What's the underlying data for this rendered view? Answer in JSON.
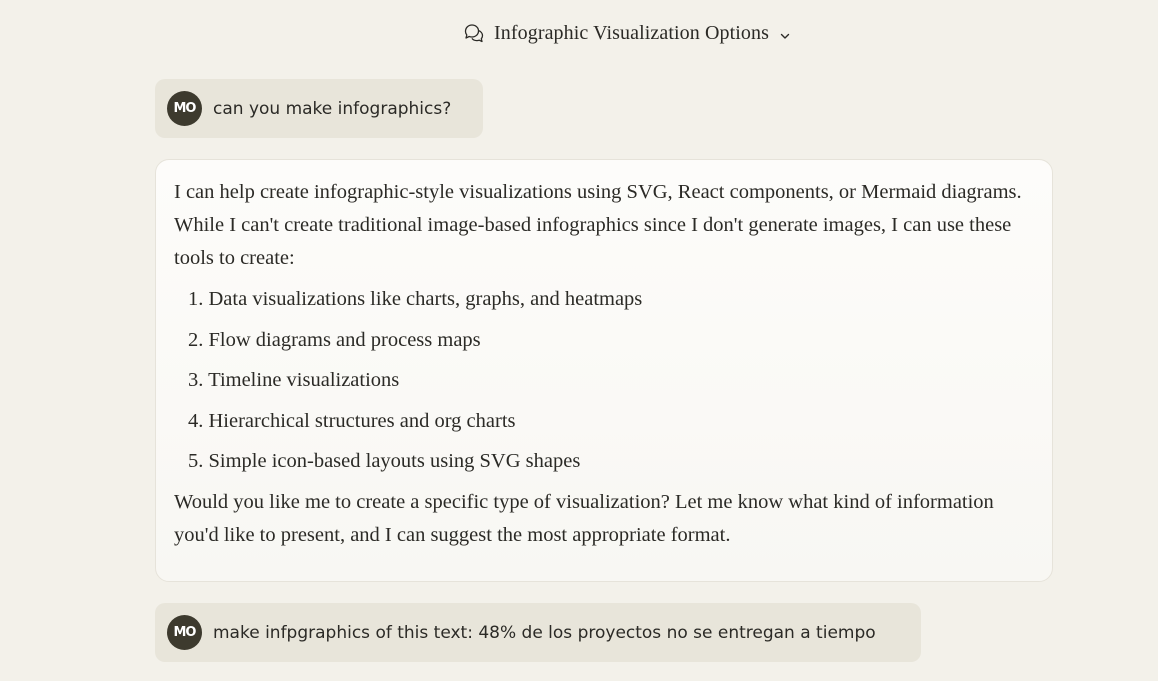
{
  "header": {
    "title": "Infographic Visualization Options",
    "icon": "chat-bubbles-icon",
    "dropdown_icon": "chevron-down-icon"
  },
  "messages": {
    "user1": {
      "avatar": "MO",
      "text": "can you make infographics?"
    },
    "assistant": {
      "intro": "I can help create infographic-style visualizations using SVG, React components, or Mermaid diagrams. While I can't create traditional image-based infographics since I don't generate images, I can use these tools to create:",
      "items": [
        {
          "num": "1.",
          "text": "Data visualizations like charts, graphs, and heatmaps"
        },
        {
          "num": "2.",
          "text": "Flow diagrams and process maps"
        },
        {
          "num": "3.",
          "text": "Timeline visualizations"
        },
        {
          "num": "4.",
          "text": "Hierarchical structures and org charts"
        },
        {
          "num": "5.",
          "text": "Simple icon-based layouts using SVG shapes"
        }
      ],
      "outro": "Would you like me to create a specific type of visualization? Let me know what kind of information you'd like to present, and I can suggest the most appropriate format."
    },
    "user2": {
      "avatar": "MO",
      "text": "make infpgraphics of this text: 48% de los proyectos no se entregan a tiempo"
    }
  },
  "colors": {
    "background": "#f3f1ea",
    "user_bubble": "#e8e5da",
    "avatar": "#3d3a2e",
    "text": "#2b2a26"
  }
}
